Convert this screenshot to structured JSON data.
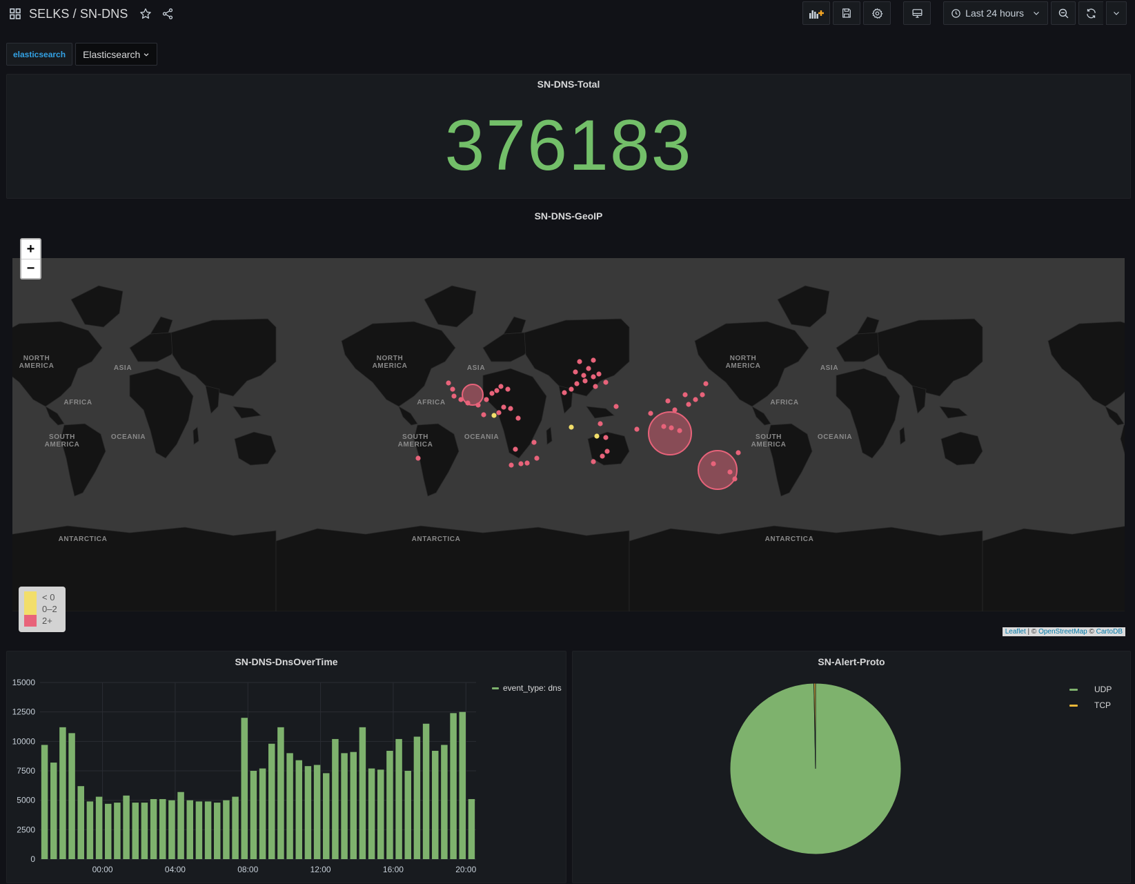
{
  "header": {
    "breadcrumb": "SELKS / SN-DNS",
    "time_range": "Last 24 hours"
  },
  "variables": {
    "label": "elasticsearch",
    "value": "Elasticsearch"
  },
  "panels": {
    "total": {
      "title": "SN-DNS-Total",
      "value": "376183"
    },
    "geoip": {
      "title": "SN-DNS-GeoIP",
      "zoom_in": "+",
      "zoom_out": "−",
      "legend": [
        {
          "label": "< 0",
          "color": "#f2de6a"
        },
        {
          "label": "0–2",
          "color": "#f2de6a"
        },
        {
          "label": "2+",
          "color": "#e8637a"
        }
      ],
      "continent_labels": [
        "NORTH AMERICA",
        "ASIA",
        "AFRICA",
        "SOUTH AMERICA",
        "OCEANIA",
        "ANTARCTICA"
      ],
      "attribution": {
        "leaflet": "Leaflet",
        "sep1": " | © ",
        "osm": "OpenStreetMap",
        "sep2": " © ",
        "carto": "CartoDB"
      }
    },
    "dns_over_time": {
      "title": "SN-DNS-DnsOverTime",
      "legend": "event_type: dns",
      "series_color": "#7eb26d"
    },
    "alert_proto": {
      "title": "SN-Alert-Proto",
      "legend": [
        {
          "label": "UDP",
          "color": "#7eb26d"
        },
        {
          "label": "TCP",
          "color": "#eab839"
        }
      ]
    }
  },
  "chart_data": [
    {
      "type": "bar",
      "title": "SN-DNS-DnsOverTime",
      "series_name": "event_type: dns",
      "x_ticks": [
        "00:00",
        "04:00",
        "08:00",
        "12:00",
        "16:00",
        "20:00"
      ],
      "y_ticks": [
        "0",
        "2500",
        "5000",
        "7500",
        "10000",
        "12500",
        "15000"
      ],
      "ylim": [
        0,
        15000
      ],
      "values": [
        9700,
        8200,
        11200,
        10700,
        6200,
        4900,
        5300,
        4700,
        4800,
        5400,
        4800,
        4800,
        5100,
        5100,
        5000,
        5700,
        5000,
        4900,
        4900,
        4800,
        5000,
        5300,
        12000,
        7500,
        7700,
        9800,
        11200,
        9000,
        8400,
        7900,
        8000,
        7300,
        10200,
        9000,
        9100,
        11200,
        7700,
        7600,
        9200,
        10200,
        7500,
        10400,
        11500,
        9200,
        9700,
        12400,
        12500,
        5100
      ]
    },
    {
      "type": "pie",
      "title": "SN-Alert-Proto",
      "categories": [
        "UDP",
        "TCP"
      ],
      "values": [
        99.7,
        0.3
      ]
    }
  ]
}
